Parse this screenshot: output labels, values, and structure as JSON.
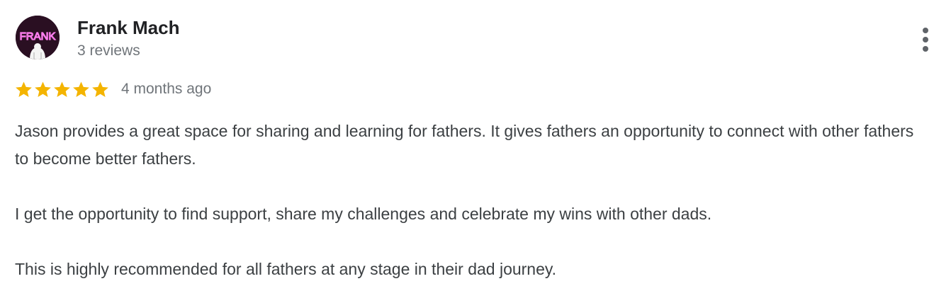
{
  "reviewer": {
    "name": "Frank Mach",
    "review_count": "3 reviews",
    "avatar_text": "FRANK"
  },
  "rating": {
    "stars": 5,
    "max_stars": 5,
    "star_color": "#f4b400",
    "date": "4 months ago"
  },
  "review": {
    "paragraphs": [
      "Jason provides a great space for sharing and learning for fathers. It gives fathers an opportunity to connect with other fathers to become better fathers.",
      "I get the opportunity to find support, share my challenges and celebrate my wins with other dads.",
      "This is highly recommended for all fathers at any stage in their dad journey."
    ]
  },
  "icons": {
    "more": "more-vert-icon",
    "star": "star-icon"
  }
}
